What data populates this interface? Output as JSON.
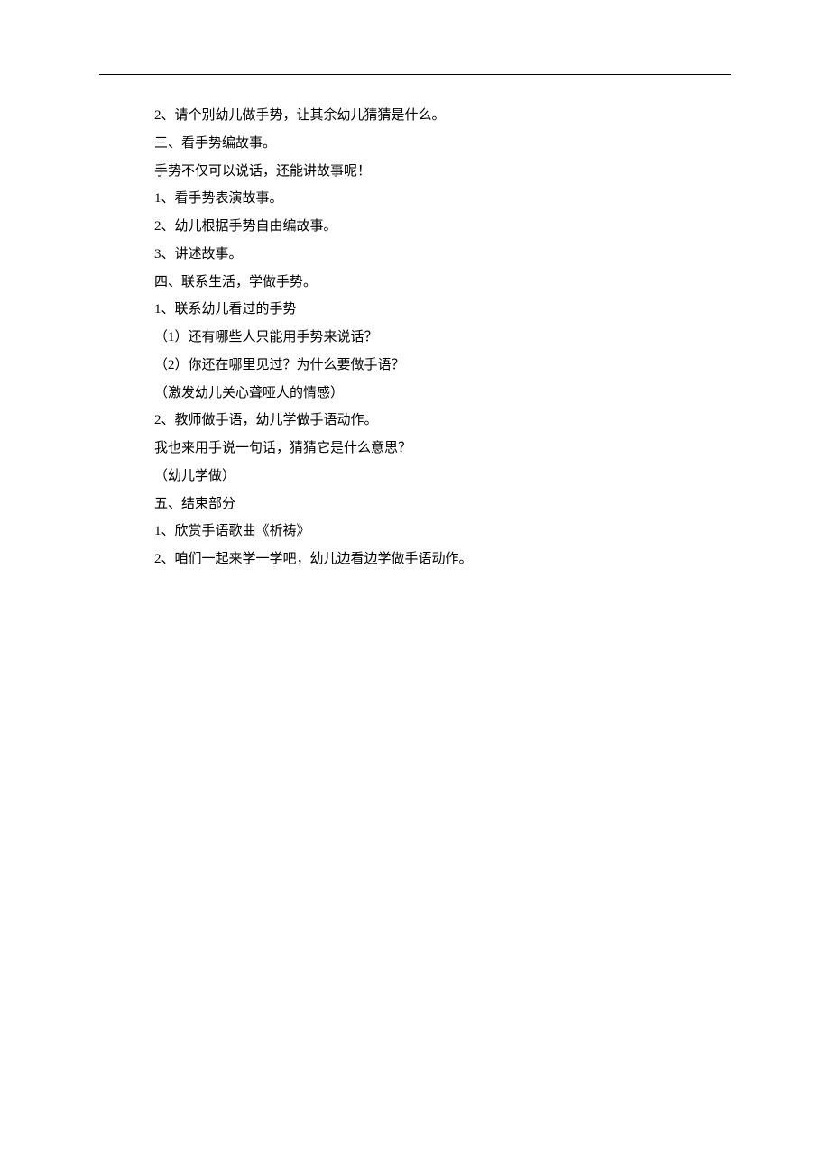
{
  "lines": [
    "2、请个别幼儿做手势，让其余幼儿猜猜是什么。",
    "三、看手势编故事。",
    "手势不仅可以说话，还能讲故事呢！",
    "1、看手势表演故事。",
    "2、幼儿根据手势自由编故事。",
    "3、讲述故事。",
    "四、联系生活，学做手势。",
    "1、联系幼儿看过的手势",
    "（1）还有哪些人只能用手势来说话？",
    "（2）你还在哪里见过？为什么要做手语？",
    "（激发幼儿关心聋哑人的情感）",
    "2、教师做手语，幼儿学做手语动作。",
    "我也来用手说一句话，猜猜它是什么意思？",
    "（幼儿学做）",
    "五、结束部分",
    "1、欣赏手语歌曲《祈祷》",
    "2、咱们一起来学一学吧，幼儿边看边学做手语动作。"
  ]
}
